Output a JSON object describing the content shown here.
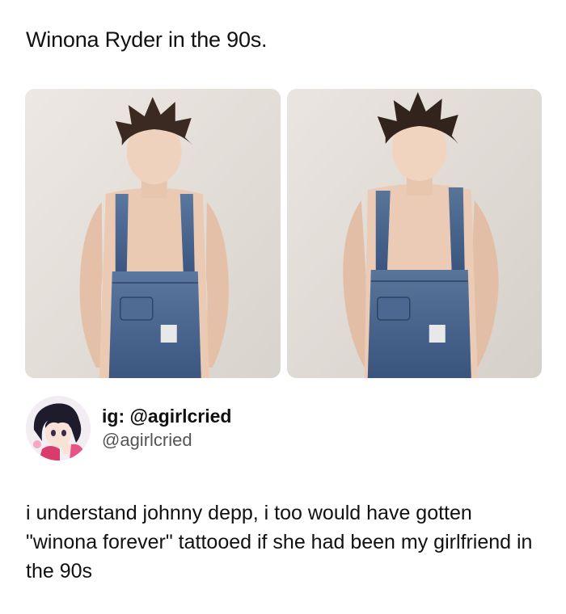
{
  "caption": "Winona Ryder in the 90s.",
  "photos": [
    {
      "alt_name": "photo-left"
    },
    {
      "alt_name": "photo-right"
    }
  ],
  "post": {
    "display_name": "ig: @agirlcried",
    "handle": "@agirlcried",
    "text": "i understand johnny depp, i too would have gotten \"winona forever\" tattooed if she had been my girlfriend in the 90s"
  },
  "colors": {
    "background": "#ffffff",
    "text": "#111111",
    "handle": "#555555",
    "denim": "#4a6690",
    "photo_bg": "#e9e4df"
  }
}
